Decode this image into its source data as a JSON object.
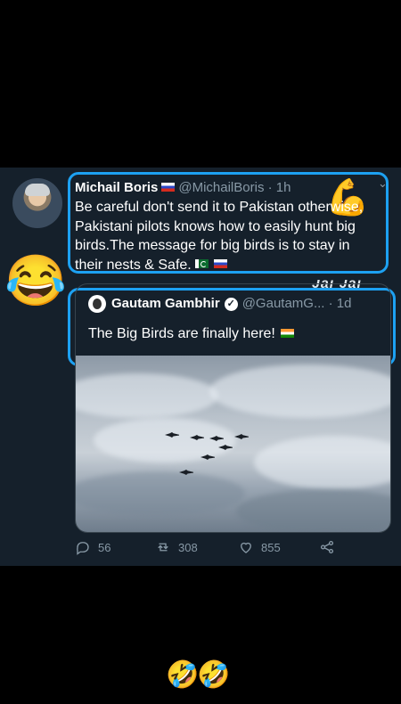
{
  "tweet": {
    "author_name": "Michail Boris",
    "author_handle": "@MichailBoris",
    "time": "· 1h",
    "text": "Be careful don't send it to Pakistan otherwise, Pakistani pilots knows how to easily hunt big birds.The message for big birds is to stay in their nests & Safe.",
    "emoji_reaction": "😂",
    "muscle_emoji": "💪"
  },
  "cropped_caption": "Jai Jai",
  "quoted_tweet": {
    "author_name": "Gautam Gambhir",
    "author_handle": "@GautamG...",
    "time": "· 1d",
    "text": "The Big Birds are finally here!"
  },
  "actions": {
    "replies": "56",
    "retweets": "308",
    "likes": "855"
  },
  "footer_emoji": "🤣🤣",
  "colors": {
    "background": "#15202b",
    "highlight": "#1da1f2",
    "muted": "#8899a6"
  }
}
